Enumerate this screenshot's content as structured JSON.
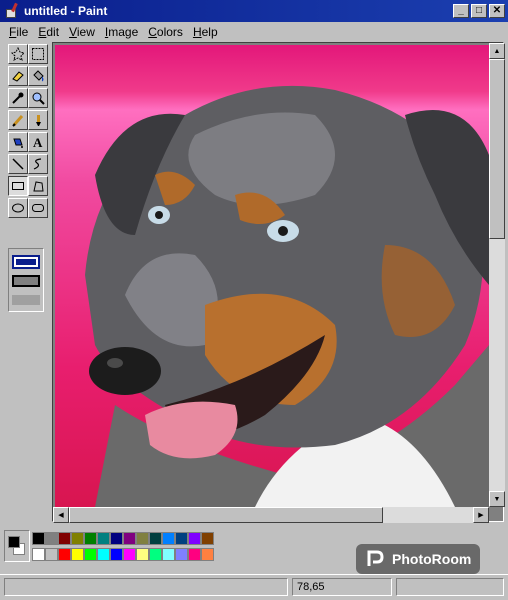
{
  "window": {
    "title": "untitled - Paint",
    "minimize_glyph": "_",
    "maximize_glyph": "□",
    "close_glyph": "✕"
  },
  "menu": [
    "File",
    "Edit",
    "View",
    "Image",
    "Colors",
    "Help"
  ],
  "toolbox": {
    "tools": [
      {
        "name": "free-form-select-tool",
        "icon": "free-form-select-icon",
        "glyph": "☆"
      },
      {
        "name": "select-tool",
        "icon": "rect-select-icon",
        "glyph": "⬚"
      },
      {
        "name": "eraser-tool",
        "icon": "eraser-icon",
        "glyph": "▱"
      },
      {
        "name": "fill-tool",
        "icon": "paint-bucket-icon",
        "glyph": "◆"
      },
      {
        "name": "pick-color-tool",
        "icon": "eyedropper-icon",
        "glyph": "⟋"
      },
      {
        "name": "magnifier-tool",
        "icon": "magnifier-icon",
        "glyph": "⚲"
      },
      {
        "name": "pencil-tool",
        "icon": "pencil-icon",
        "glyph": "✎"
      },
      {
        "name": "brush-tool",
        "icon": "brush-icon",
        "glyph": "▮"
      },
      {
        "name": "airbrush-tool",
        "icon": "airbrush-icon",
        "glyph": "◒"
      },
      {
        "name": "text-tool",
        "icon": "text-icon",
        "glyph": "A"
      },
      {
        "name": "line-tool",
        "icon": "line-icon",
        "glyph": "╲"
      },
      {
        "name": "curve-tool",
        "icon": "curve-icon",
        "glyph": "∿"
      },
      {
        "name": "rectangle-tool",
        "icon": "rectangle-icon",
        "glyph": "▭"
      },
      {
        "name": "polygon-tool",
        "icon": "polygon-icon",
        "glyph": "⏢"
      },
      {
        "name": "ellipse-tool",
        "icon": "ellipse-icon",
        "glyph": "⬭"
      },
      {
        "name": "rounded-rectangle-tool",
        "icon": "rounded-rectangle-icon",
        "glyph": "▢"
      }
    ],
    "active_tool": "rectangle-tool",
    "fill_style_options": [
      "outline",
      "outline-fill",
      "fill-only"
    ],
    "selected_fill_style": "outline"
  },
  "canvas": {
    "content": "photo-of-dog",
    "background_colors": [
      "#e3177a",
      "#ff6fc0",
      "#d81550"
    ]
  },
  "palette": {
    "foreground": "#000000",
    "background": "#ffffff",
    "colors_top": [
      "#000000",
      "#808080",
      "#800000",
      "#808000",
      "#008000",
      "#008080",
      "#000080",
      "#800080",
      "#808040",
      "#004040",
      "#0080ff",
      "#004080",
      "#8000ff",
      "#804000"
    ],
    "colors_bottom": [
      "#ffffff",
      "#c0c0c0",
      "#ff0000",
      "#ffff00",
      "#00ff00",
      "#00ffff",
      "#0000ff",
      "#ff00ff",
      "#ffff80",
      "#00ff80",
      "#80ffff",
      "#8080ff",
      "#ff0080",
      "#ff8040"
    ]
  },
  "watermark": {
    "text": "PhotoRoom",
    "icon": "photoroom-logo-icon"
  },
  "status": {
    "message": "",
    "coordinates": "78,65",
    "size": ""
  },
  "colors": {
    "titlebar": "#0a1e8c",
    "chrome": "#c0c0c0"
  }
}
